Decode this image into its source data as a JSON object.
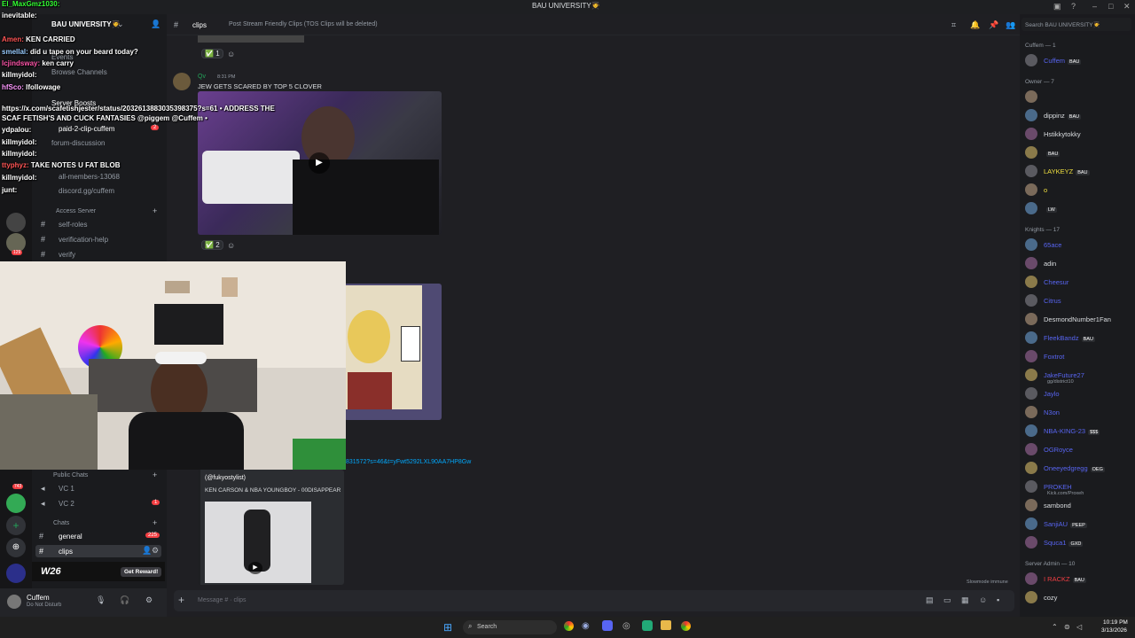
{
  "titlebar": {
    "title": "BAU UNIVERSITY🧑‍🎓"
  },
  "server": {
    "name": "BAU UNIVERSITY🧑‍🎓"
  },
  "sidebar": {
    "top_items": [
      "Events",
      "Browse Channels",
      "Server Boosts"
    ],
    "channels": [
      "paid-2-clip-cuffem",
      "forum-discussion",
      "all-members-13068",
      "discord.gg/cuffem"
    ],
    "access_category": "Access Server",
    "access_channels": [
      "self-roles",
      "verification-help",
      "verify"
    ],
    "public_category": "Public Chats",
    "voice": [
      "VC 1",
      "VC 2"
    ],
    "chats_category": "Chats",
    "text": [
      "general",
      "clips"
    ],
    "badge_general": "225",
    "badge_vc2": "1",
    "badge_boost": "2",
    "server_badges": [
      "NEW",
      "129",
      "743"
    ]
  },
  "promo": {
    "title": "W26",
    "button": "Get Reward!"
  },
  "user": {
    "name": "Cuffem",
    "status": "Do Not Disturb"
  },
  "chat_overlay": [
    {
      "user": "El_MaxGmz1030:",
      "msg": ""
    },
    {
      "user": "inevitable:",
      "msg": ""
    },
    {
      "user": "Amen:",
      "msg": "KEN CARRIED"
    },
    {
      "user": "smellal:",
      "msg": "did u tape on your beard today?"
    },
    {
      "user": "lcjindsway:",
      "msg": "ken carry"
    },
    {
      "user": "killmyidol:",
      "msg": ""
    },
    {
      "user": "hfSco:",
      "msg": "lfollowage"
    },
    {
      "user": "",
      "msg": "https://x.com/scafetishjester/status/2032613883035398375?s=61 • ADDRESS THE"
    },
    {
      "user": "",
      "msg": "SCAF FETISH'S AND CUCK FANTASIES @piggem @Cuffem •"
    },
    {
      "user": "ydpalou:",
      "msg": ""
    },
    {
      "user": "killmyidol:",
      "msg": ""
    },
    {
      "user": "killmyidol:",
      "msg": ""
    },
    {
      "user": "ttyphyz:",
      "msg": "TAKE NOTES U FAT BLOB"
    },
    {
      "user": "killmyidol:",
      "msg": ""
    },
    {
      "user": "junt:",
      "msg": ""
    }
  ],
  "channel_header": {
    "name": "clips",
    "topic": "Post Stream Friendly Clips (TOS Clips will be deleted)",
    "search_placeholder": "Search BAU UNIVERSITY🧑‍🎓"
  },
  "messages": {
    "reaction1_count": "1",
    "author": "Qv",
    "time": "8:31 PM",
    "text": "JEW GETS SCARED BY TOP 5 CLOVER",
    "reaction2_count": "2",
    "link_fragment": "831572?s=46&t=yFwt5292LXL90AA7HP8Gw",
    "embed_author": "(@fukyostylist)",
    "embed_title": "KEN CARSON & NBA YOUNGBOY - 00DISAPPEAR",
    "slowmode": "Slowmode immune",
    "composer_placeholder": "Message # · clips"
  },
  "members": {
    "groups": [
      {
        "title": "Cuffem — 1",
        "items": [
          {
            "name": "Cuffem",
            "badge": "BAU",
            "color": "#5865f2"
          }
        ]
      },
      {
        "title": "Owner — 7",
        "items": [
          {
            "name": "",
            "badge": "",
            "color": "#949ba4"
          },
          {
            "name": "dippinz",
            "badge": "BAU",
            "color": "#dbdee1"
          },
          {
            "name": "Hstikkytokky",
            "badge": "",
            "color": "#dbdee1"
          },
          {
            "name": "",
            "badge": "BAU",
            "color": "#949ba4"
          },
          {
            "name": "LAYKEYZ",
            "badge": "BAU",
            "color": "#f0e040"
          },
          {
            "name": "o",
            "badge": "",
            "color": "#f0e040"
          },
          {
            "name": "",
            "badge": "LW",
            "color": "#949ba4"
          }
        ]
      },
      {
        "title": "Knights — 17",
        "items": [
          {
            "name": "65ace",
            "badge": "",
            "color": "#5865f2"
          },
          {
            "name": "adin",
            "badge": "",
            "color": "#dbdee1"
          },
          {
            "name": "Cheesur",
            "badge": "",
            "color": "#5865f2"
          },
          {
            "name": "Citrus",
            "badge": "",
            "color": "#5865f2"
          },
          {
            "name": "DesmondNumber1Fan",
            "badge": "",
            "color": "#dbdee1"
          },
          {
            "name": "FleekBandz",
            "badge": "BAU",
            "color": "#5865f2"
          },
          {
            "name": "Foxtrot",
            "badge": "",
            "color": "#5865f2"
          },
          {
            "name": "JakeFuture27",
            "badge": "",
            "color": "#5865f2"
          },
          {
            "name": "Jaylo",
            "badge": "",
            "color": "#5865f2"
          },
          {
            "name": "N3on",
            "badge": "",
            "color": "#5865f2"
          },
          {
            "name": "NBA-KING-23",
            "badge": "$$$",
            "color": "#5865f2"
          },
          {
            "name": "OGRoyce",
            "badge": "",
            "color": "#5865f2"
          },
          {
            "name": "Oneeyedgregg",
            "badge": "OEG",
            "color": "#5865f2"
          },
          {
            "name": "PROKEH",
            "badge": "",
            "color": "#5865f2"
          },
          {
            "name": "sambond",
            "badge": "",
            "color": "#dbdee1"
          },
          {
            "name": "SanjiAU",
            "badge": "PEEP",
            "color": "#5865f2"
          },
          {
            "name": "Squca1",
            "badge": "GXD",
            "color": "#5865f2"
          }
        ]
      },
      {
        "title": "Server Admin — 10",
        "items": [
          {
            "name": "I RACKZ",
            "badge": "BAU",
            "color": "#f23f43"
          },
          {
            "name": "cozy",
            "badge": "",
            "color": "#dbdee1"
          }
        ]
      }
    ],
    "jake_sub": "gg/district10",
    "prokeh_sub": "Kick.com/Proxeh"
  },
  "taskbar": {
    "search": "Search",
    "time": "10:19 PM",
    "date": "3/13/2026"
  }
}
